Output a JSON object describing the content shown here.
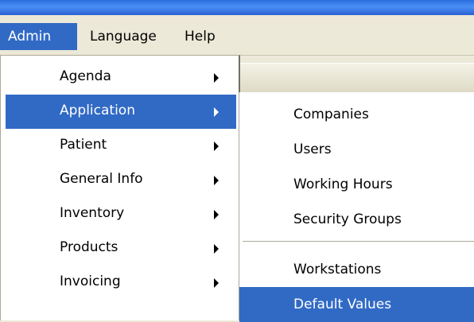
{
  "menubar": {
    "items": [
      {
        "label": "Admin"
      },
      {
        "label": "Language"
      },
      {
        "label": "Help"
      }
    ]
  },
  "admin_menu": {
    "items": [
      {
        "label": "Agenda",
        "has_submenu": true
      },
      {
        "label": "Application",
        "has_submenu": true,
        "highlighted": true
      },
      {
        "label": "Patient",
        "has_submenu": true
      },
      {
        "label": "General Info",
        "has_submenu": true
      },
      {
        "label": "Inventory",
        "has_submenu": true
      },
      {
        "label": "Products",
        "has_submenu": true
      },
      {
        "label": "Invoicing",
        "has_submenu": true
      }
    ]
  },
  "application_submenu": {
    "items": [
      {
        "label": "Companies"
      },
      {
        "label": "Users"
      },
      {
        "label": "Working Hours"
      },
      {
        "label": "Security Groups"
      },
      {
        "label": "Workstations"
      },
      {
        "label": "Default Values",
        "highlighted": true
      }
    ]
  },
  "colors": {
    "highlight": "#316ac5",
    "menubar_bg": "#ece9d8",
    "title_bar": "#2a6ee0"
  },
  "icons": {
    "submenu_arrow": "triangle-right-icon"
  }
}
